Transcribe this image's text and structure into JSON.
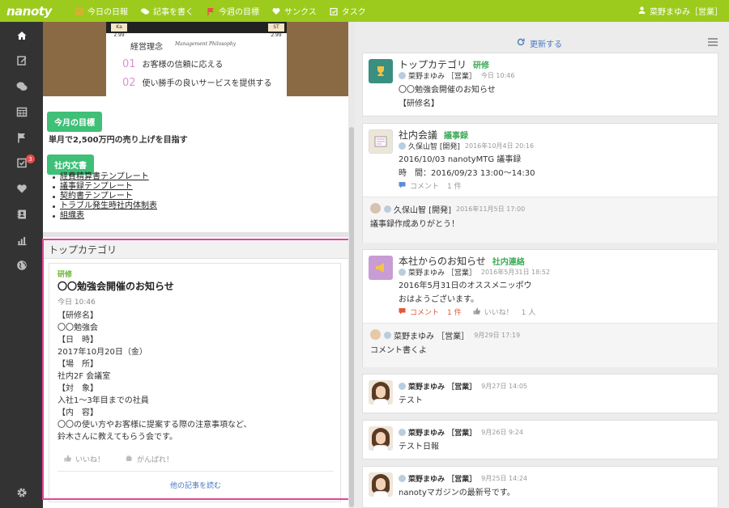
{
  "app": {
    "logo": "nanoty",
    "nav": [
      {
        "label": "今日の日報",
        "icon": "daily-report-icon"
      },
      {
        "label": "記事を書く",
        "icon": "write-article-icon"
      },
      {
        "label": "今週の目標",
        "icon": "flag-icon"
      },
      {
        "label": "サンクス",
        "icon": "heart-icon"
      },
      {
        "label": "タスク",
        "icon": "task-icon"
      }
    ],
    "user": "菜野まゆみ［営業］"
  },
  "sidebar": {
    "items": [
      {
        "name": "home-icon"
      },
      {
        "name": "report-icon"
      },
      {
        "name": "chat-icon"
      },
      {
        "name": "calendar-icon"
      },
      {
        "name": "flag-icon"
      },
      {
        "name": "task-icon",
        "badge": "3"
      },
      {
        "name": "heart-icon"
      },
      {
        "name": "contacts-icon"
      },
      {
        "name": "stats-icon"
      },
      {
        "name": "globe-icon"
      },
      {
        "name": "settings-icon"
      }
    ]
  },
  "philosophy": {
    "tag_left": "Ka 2.99",
    "tag_right": "ST 2.99",
    "title": "経営理念",
    "subtitle": "Management Philosophy",
    "items": [
      {
        "num": "01",
        "text": "お客様の信頼に応える"
      },
      {
        "num": "02",
        "text": "使い勝手の良いサービスを提供する"
      }
    ]
  },
  "monthly_goal": {
    "label": "今月の目標",
    "text": "単月で2,500万円の売り上げを目指す"
  },
  "internal_docs": {
    "label": "社内文書",
    "items": [
      "経費精算書テンプレート",
      "議事録テンプレート",
      "契約書テンプレート",
      "トラブル発生時社内体制表",
      "組織表"
    ]
  },
  "top_category": {
    "header": "トップカテゴリ",
    "article": {
      "category": "研修",
      "title": "〇〇勉強会開催のお知らせ",
      "time": "今日 10:46",
      "body": [
        "【研修名】",
        "〇〇勉強会",
        "【日　時】",
        "2017年10月20日（金）",
        "【場　所】",
        "社内2F 会議室",
        "【対　象】",
        "入社1〜3年目までの社員",
        "【内　容】",
        "〇〇の使い方やお客様に提案する際の注意事項など、",
        "鈴木さんに教えてもらう会です。"
      ],
      "like_label": "いいね！",
      "cheer_label": "がんばれ！",
      "more_label": "他の記事を読む"
    }
  },
  "feed": {
    "refresh_label": "更新する",
    "cards": [
      {
        "category": "トップカテゴリ",
        "tag": "研修",
        "author": "菜野まゆみ ［営業］",
        "date": "今日 10:46",
        "lines": [
          "〇〇勉強会開催のお知らせ",
          "【研修名】"
        ]
      },
      {
        "category": "社内会議",
        "tag": "議事録",
        "author": "久保山智 [開発]",
        "date": "2016年10月4日 20:16",
        "lines": [
          "2016/10/03 nanotyMTG 議事録",
          "時　間：2016/09/23 13:00〜14:30"
        ],
        "comment_label": "コメント",
        "comment_count": "1 件",
        "reply": {
          "author": "久保山智 [開発]",
          "date": "2016年11月5日 17:00",
          "text": "議事録作成ありがとう！"
        }
      },
      {
        "category": "本社からのお知らせ",
        "tag": "社内連絡",
        "author": "菜野まゆみ ［営業］",
        "date": "2016年5月31日 18:52",
        "lines": [
          "2016年5月31日のオススメニッポウ",
          "おはようございます。"
        ],
        "comment_label": "コメント",
        "comment_count": "1 件",
        "like_label": "いいね！",
        "like_count": "1 人",
        "reply": {
          "author": "菜野まゆみ ［営業］",
          "date": "9月29日 17:19",
          "text": "コメント書くよ"
        }
      },
      {
        "author": "菜野まゆみ ［営業］",
        "date": "9月27日 14:05",
        "text": "テスト"
      },
      {
        "author": "菜野まゆみ ［営業］",
        "date": "9月26日 9:24",
        "text": "テスト日報"
      },
      {
        "author": "菜野まゆみ ［営業］",
        "date": "9月25日 14:24",
        "text": "nanotyマガジンの最新号です。"
      }
    ]
  },
  "colors": {
    "topbar": "#9ccb1d",
    "sidebar": "#333333",
    "green_label": "#3fbf77",
    "highlight": "#e0469a",
    "link": "#4a78c0"
  }
}
